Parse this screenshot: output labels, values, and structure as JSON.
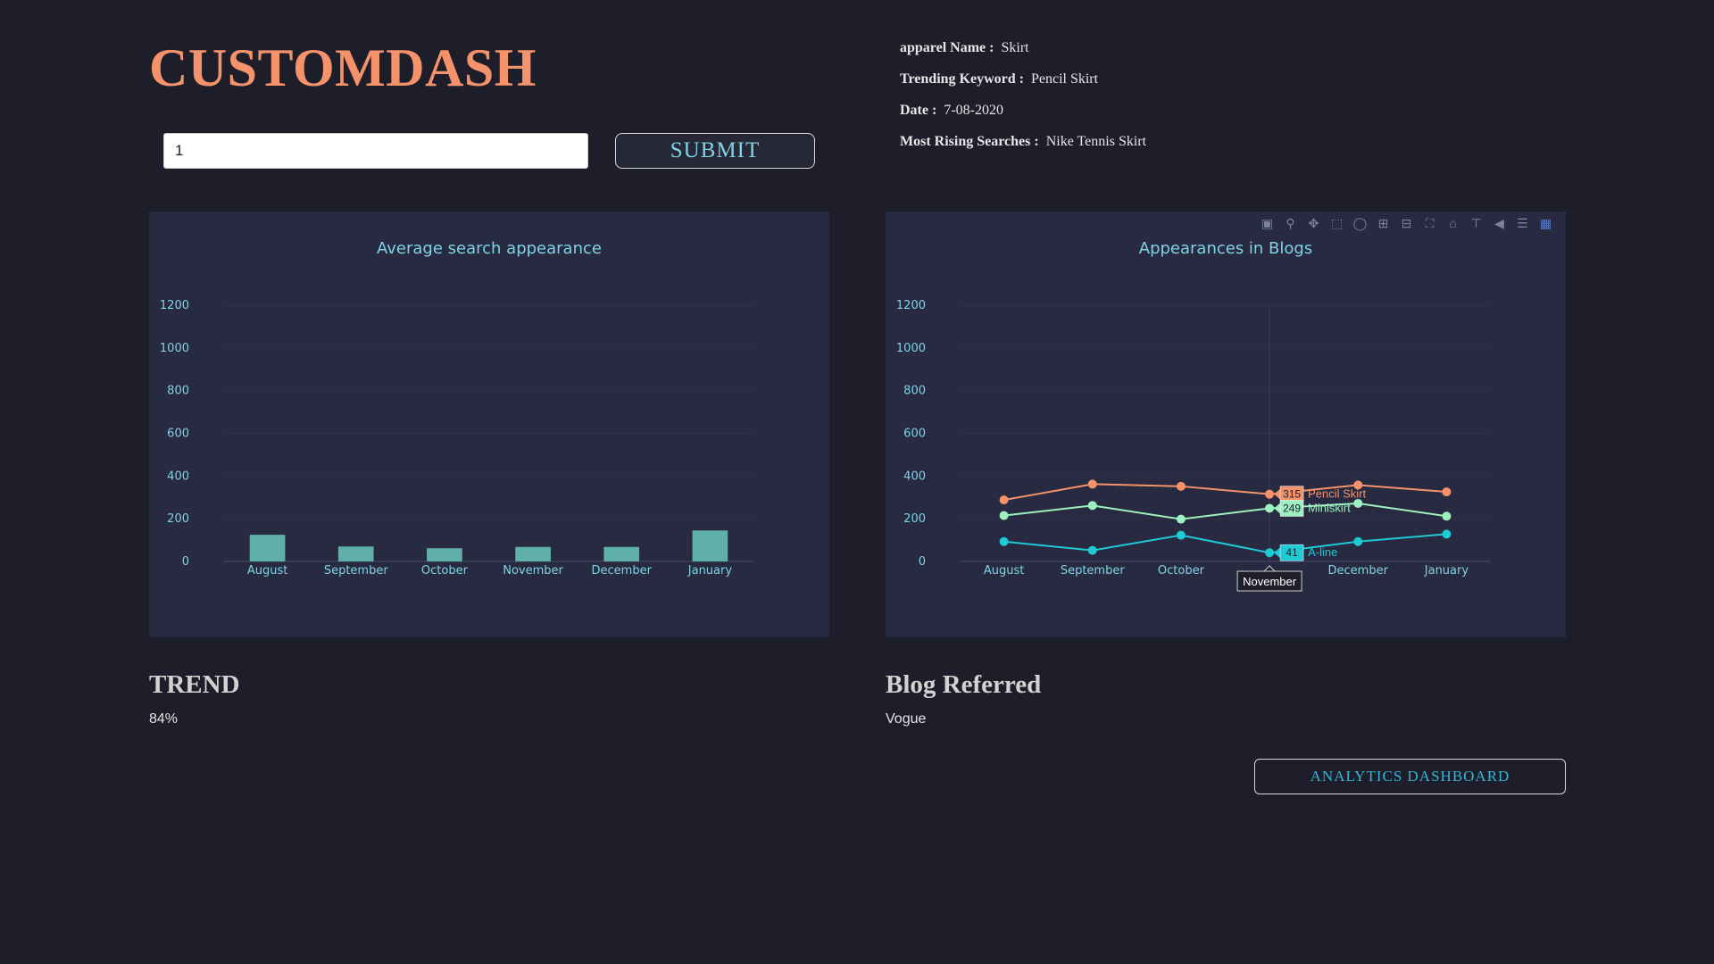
{
  "app": {
    "title": "CUSTOMDASH"
  },
  "search": {
    "value": "1",
    "submit_label": "SUBMIT"
  },
  "info": {
    "apparel_name_label": "apparel Name :",
    "apparel_name": "Skirt",
    "trending_keyword_label": "Trending Keyword :",
    "trending_keyword": "Pencil Skirt",
    "date_label": "Date :",
    "date": "7-08-2020",
    "rising_label": "Most Rising Searches :",
    "rising": "Nike Tennis Skirt"
  },
  "colors": {
    "title": "#f4926c",
    "accent": "#7fd3e4",
    "bars": "#5fb0a8",
    "pencil_skirt": "#f4926c",
    "miniskirt": "#9ff0c0",
    "a_line": "#1ecbd4"
  },
  "modebar": {
    "icons": [
      "camera-icon",
      "zoom-icon",
      "pan-icon",
      "box-select-icon",
      "lasso-icon",
      "zoom-in-icon",
      "zoom-out-icon",
      "autoscale-icon",
      "reset-axes-icon",
      "spike-lines-icon",
      "hover-closest-icon",
      "hover-compare-icon",
      "plotly-logo-icon"
    ]
  },
  "chart_data": [
    {
      "type": "bar",
      "title": "Average search appearance",
      "categories": [
        "August",
        "September",
        "October",
        "November",
        "December",
        "January"
      ],
      "values": [
        125,
        70,
        62,
        68,
        68,
        145
      ],
      "ylim": [
        0,
        1200
      ],
      "yticks": [
        0,
        200,
        400,
        600,
        800,
        1000,
        1200
      ],
      "xlabel": "",
      "ylabel": "",
      "grid": true
    },
    {
      "type": "line",
      "title": "Appearances in Blogs",
      "categories": [
        "August",
        "September",
        "October",
        "November",
        "December",
        "January"
      ],
      "series": [
        {
          "name": "Pencil Skirt",
          "values": [
            288,
            362,
            352,
            315,
            358,
            326
          ]
        },
        {
          "name": "Miniskirt",
          "values": [
            215,
            262,
            198,
            249,
            272,
            212
          ]
        },
        {
          "name": "A-line",
          "values": [
            93,
            52,
            123,
            41,
            93,
            128
          ]
        }
      ],
      "ylim": [
        0,
        1200
      ],
      "yticks": [
        0,
        200,
        400,
        600,
        800,
        1000,
        1200
      ],
      "xlabel": "",
      "ylabel": "",
      "grid": true,
      "hover": {
        "category": "November",
        "labels": [
          "315",
          "249",
          "41"
        ]
      }
    }
  ],
  "trend": {
    "title": "TREND",
    "value": "84%"
  },
  "blog": {
    "title": "Blog Referred",
    "value": "Vogue"
  },
  "analytics": {
    "label": "ANALYTICS DASHBOARD"
  }
}
